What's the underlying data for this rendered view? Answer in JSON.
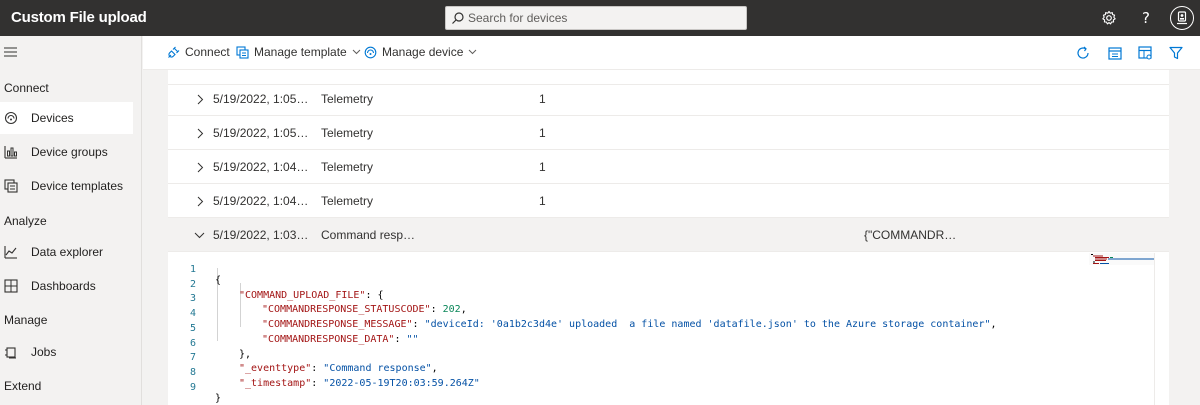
{
  "app": {
    "title": "Custom File upload"
  },
  "search": {
    "placeholder": "Search for devices"
  },
  "sidebar": {
    "sections": [
      {
        "label": "Connect",
        "items": [
          {
            "label": "Devices",
            "icon": "devices-icon",
            "active": true
          },
          {
            "label": "Device groups",
            "icon": "device-groups-icon"
          },
          {
            "label": "Device templates",
            "icon": "device-templates-icon"
          }
        ]
      },
      {
        "label": "Analyze",
        "items": [
          {
            "label": "Data explorer",
            "icon": "data-explorer-icon"
          },
          {
            "label": "Dashboards",
            "icon": "dashboards-icon"
          }
        ]
      },
      {
        "label": "Manage",
        "items": [
          {
            "label": "Jobs",
            "icon": "jobs-icon"
          }
        ]
      },
      {
        "label": "Extend",
        "items": []
      }
    ]
  },
  "toolbar": {
    "connect": "Connect",
    "manage_template": "Manage template",
    "manage_device": "Manage device"
  },
  "rows": [
    {
      "timestamp": "5/19/2022, 1:05…",
      "type": "Telemetry",
      "count": "1",
      "value": ""
    },
    {
      "timestamp": "5/19/2022, 1:05…",
      "type": "Telemetry",
      "count": "1",
      "value": ""
    },
    {
      "timestamp": "5/19/2022, 1:04…",
      "type": "Telemetry",
      "count": "1",
      "value": ""
    },
    {
      "timestamp": "5/19/2022, 1:04…",
      "type": "Telemetry",
      "count": "1",
      "value": ""
    },
    {
      "timestamp": "5/19/2022, 1:03…",
      "type": "Command resp…",
      "count": "",
      "value": "{\"COMMANDR…",
      "expanded": true
    }
  ],
  "code": {
    "line_numbers": [
      "1",
      "2",
      "3",
      "4",
      "5",
      "6",
      "7",
      "8",
      "9"
    ],
    "l1": "{",
    "l2_key": "\"COMMAND_UPLOAD_FILE\"",
    "l2_rest": ": {",
    "l3_key": "\"COMMANDRESPONSE_STATUSCODE\"",
    "l3_sep": ": ",
    "l3_val": "202",
    "l3_end": ",",
    "l4_key": "\"COMMANDRESPONSE_MESSAGE\"",
    "l4_sep": ": ",
    "l4_val": "\"deviceId: '0a1b2c3d4e' uploaded  a file named 'datafile.json' to the Azure storage container\"",
    "l4_end": ",",
    "l5_key": "\"COMMANDRESPONSE_DATA\"",
    "l5_sep": ": ",
    "l5_val": "\"\"",
    "l6": "},",
    "l7_key": "\"_eventtype\"",
    "l7_sep": ": ",
    "l7_val": "\"Command response\"",
    "l7_end": ",",
    "l8_key": "\"_timestamp\"",
    "l8_sep": ": ",
    "l8_val": "\"2022-05-19T20:03:59.264Z\"",
    "l9": "}"
  },
  "colors": {
    "topbar": "#323130",
    "accent": "#0078d4",
    "json_key": "#a31515",
    "json_string": "#0451a5",
    "json_number": "#098658"
  }
}
